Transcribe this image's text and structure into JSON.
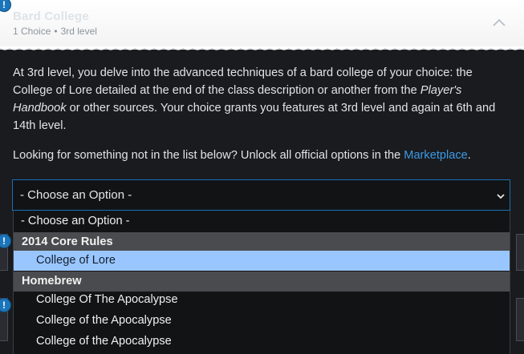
{
  "panel": {
    "title": "Bard College",
    "choices": "1 Choice",
    "level": "3rd level",
    "separator": "•"
  },
  "badges": [
    "!",
    "!",
    "!"
  ],
  "description": {
    "part1": "At 3rd level, you delve into the advanced techniques of a bard college of your choice: the College of Lore detailed at the end of the class description or another from the ",
    "italic": "Player's Handbook",
    "part2": " or other sources. Your choice grants you features at 3rd level and again at 6th and 14th level."
  },
  "unlock": {
    "text": "Looking for something not in the list below? Unlock all official options in the ",
    "link": "Marketplace",
    "end": "."
  },
  "select": {
    "value": "- Choose an Option -",
    "options": [
      {
        "type": "placeholder",
        "label": "- Choose an Option -"
      },
      {
        "type": "group",
        "label": "2014 Core Rules"
      },
      {
        "type": "item",
        "label": "College of Lore",
        "selected": true
      },
      {
        "type": "group",
        "label": "Homebrew"
      },
      {
        "type": "item",
        "label": "College Of The Apocalypse"
      },
      {
        "type": "item",
        "label": "College of the Apocalypse"
      },
      {
        "type": "item",
        "label": "College of the Apocalypse"
      }
    ]
  },
  "colors": {
    "accent": "#1d6fb8",
    "link": "#3b9be8",
    "selected_option": "#99c6ff",
    "group_header": "#4a4b4e"
  }
}
